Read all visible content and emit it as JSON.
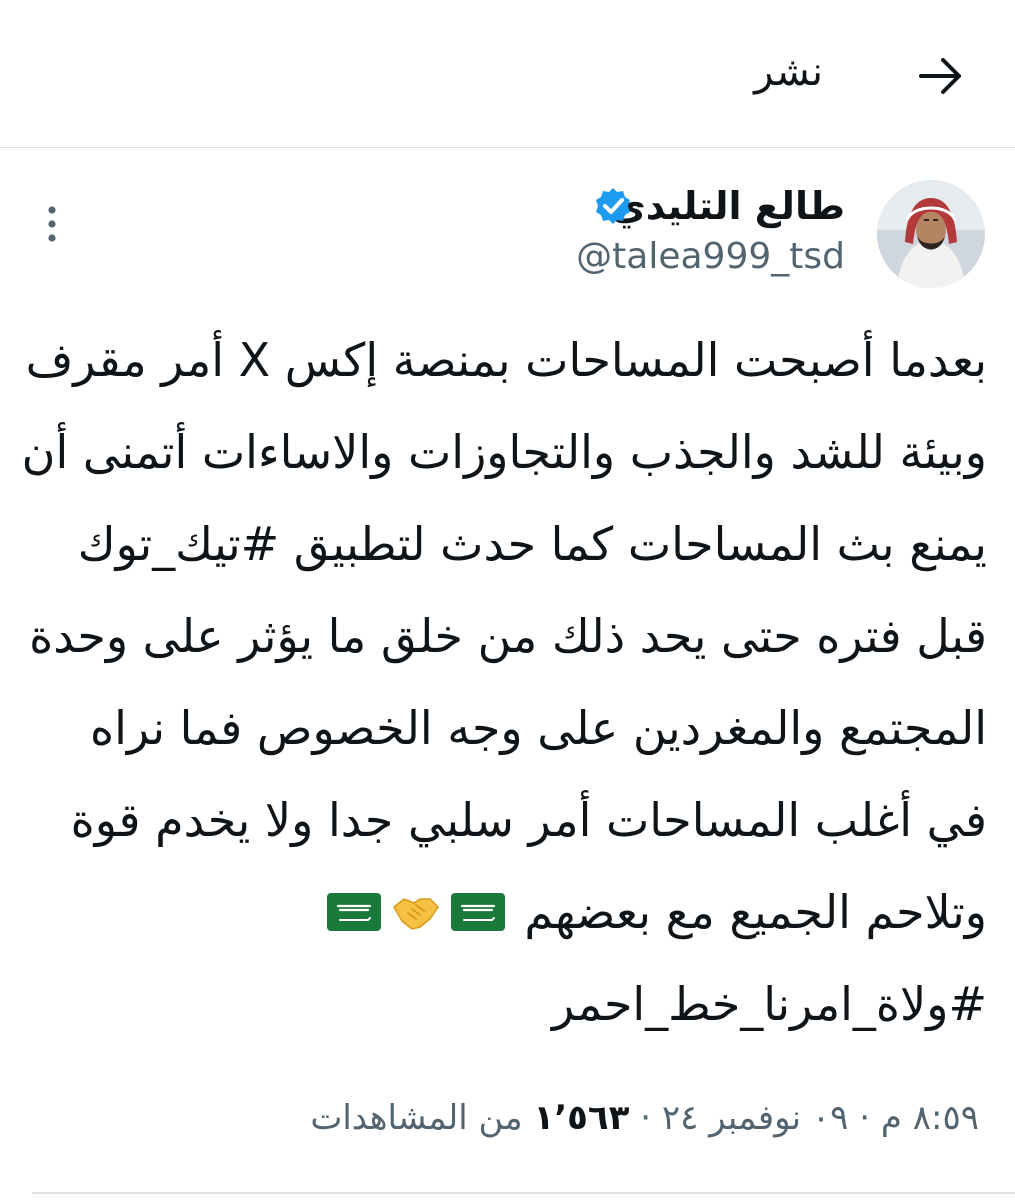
{
  "header": {
    "title": "نشر",
    "back_icon": "arrow-right-icon"
  },
  "tweet": {
    "author": {
      "name": "طالع التليدي",
      "handle": "@talea999_tsd",
      "verified": true,
      "verified_color": "#1d9bf0"
    },
    "text_lines": [
      "بعدما أصبحت المساحات بمنصة إكس X أمر مقرف",
      "وبيئة للشد والجذب والتجاوزات والاساءات أتمنى أن",
      "يمنع بث المساحات  كما حدث لتطبيق #تيك_توك",
      "قبل فتره حتى يحد ذلك من خلق ما يؤثر على وحدة",
      "المجتمع والمغردين على وجه الخصوص فما نراه",
      "في أغلب المساحات أمر سلبي جدا ولا يخدم قوة",
      "وتلاحم الجميع مع بعضهم",
      "#ولاة_امرنا_خط_احمر"
    ],
    "emojis": [
      "saudi-flag-icon",
      "handshake-icon",
      "saudi-flag-icon"
    ],
    "time": "٨:٥٩ م",
    "date": "٠٩ نوفمبر ٢٤",
    "views_count": "١٬٥٦٣",
    "views_label": "من المشاهدات",
    "separator": "·"
  }
}
